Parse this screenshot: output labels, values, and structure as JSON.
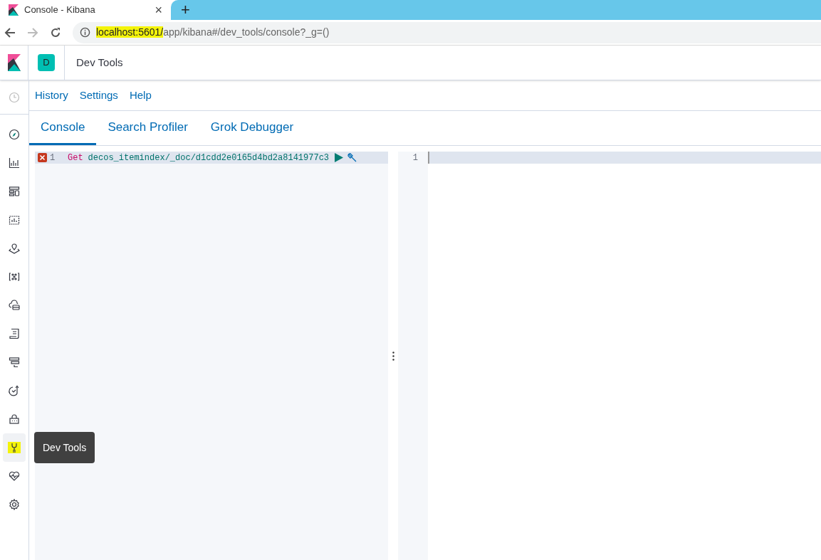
{
  "browser": {
    "tab_title": "Console - Kibana",
    "tab_close": "×",
    "new_tab": "+",
    "url_host": "localhost:5601/",
    "url_path": "app/kibana#/dev_tools/console?_g=()",
    "url_host_highlighted": true
  },
  "header": {
    "space_initial": "D",
    "title": "Dev Tools"
  },
  "sidebar": {
    "items": [
      {
        "kind": "clock",
        "selected": false,
        "highlighted": false
      },
      {
        "kind": "compass",
        "selected": false,
        "highlighted": false
      },
      {
        "kind": "chart",
        "selected": false,
        "highlighted": false
      },
      {
        "kind": "dashboard",
        "selected": false,
        "highlighted": false
      },
      {
        "kind": "canvas",
        "selected": false,
        "highlighted": false
      },
      {
        "kind": "map",
        "selected": false,
        "highlighted": false
      },
      {
        "kind": "ml",
        "selected": false,
        "highlighted": false
      },
      {
        "kind": "cloud",
        "selected": false,
        "highlighted": false
      },
      {
        "kind": "logs",
        "selected": false,
        "highlighted": false
      },
      {
        "kind": "apm",
        "selected": false,
        "highlighted": false
      },
      {
        "kind": "uptime",
        "selected": false,
        "highlighted": false
      },
      {
        "kind": "lock",
        "selected": false,
        "highlighted": false
      },
      {
        "kind": "wrench",
        "selected": true,
        "highlighted": true
      },
      {
        "kind": "heart",
        "selected": false,
        "highlighted": false
      },
      {
        "kind": "gear",
        "selected": false,
        "highlighted": false
      }
    ],
    "tooltip": "Dev Tools"
  },
  "menu": [
    "History",
    "Settings",
    "Help"
  ],
  "tabs": [
    {
      "label": "Console",
      "selected": true
    },
    {
      "label": "Search Profiler",
      "selected": false
    },
    {
      "label": "Grok Debugger",
      "selected": false
    }
  ],
  "request_editor": {
    "lines": [
      {
        "number": "1",
        "error": true,
        "method": "Get",
        "path": "decos_itemindex/_doc/d1cdd2e0165d4bd2a8141977c3"
      }
    ]
  },
  "response_editor": {
    "lines": [
      {
        "number": "1"
      }
    ]
  }
}
